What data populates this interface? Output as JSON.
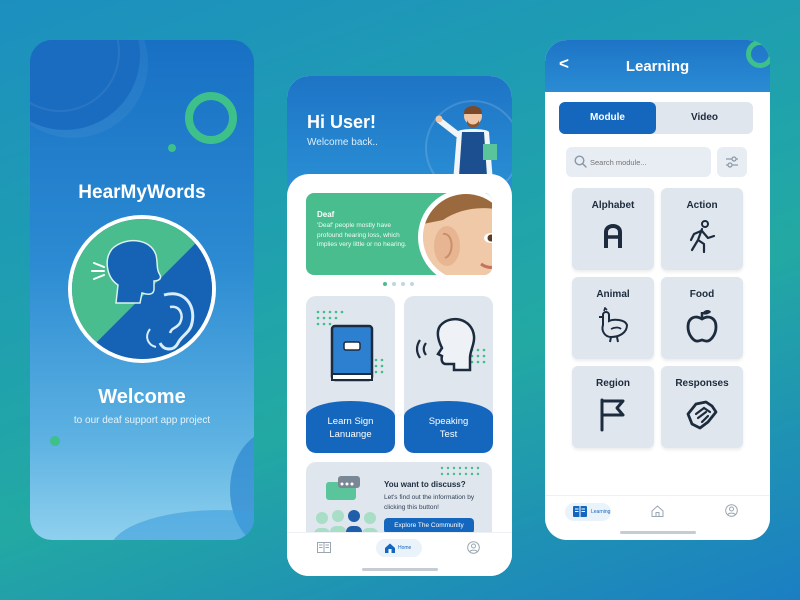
{
  "welcome_screen": {
    "app_title": "HearMyWords",
    "heading": "Welcome",
    "subtitle": "to our deaf support app project"
  },
  "home_screen": {
    "greeting": "Hi User!",
    "welcome_back": "Welcome back..",
    "banner": {
      "title": "Deaf",
      "description": "'Deaf' people mostly have profound hearing loss, which implies very little or no hearing."
    },
    "carousel_dots": 4,
    "tiles": [
      {
        "label_line1": "Learn Sign",
        "label_line2": "Lanuange"
      },
      {
        "label_line1": "Speaking",
        "label_line2": "Test"
      }
    ],
    "community": {
      "question": "You want to discuss?",
      "description": "Let's find out the information by clicking this button!",
      "button": "Explore The Community"
    },
    "nav": {
      "home_label": "Home"
    }
  },
  "learning_screen": {
    "back_glyph": "<",
    "title": "Learning",
    "tabs": [
      "Module",
      "Video"
    ],
    "active_tab": "Module",
    "search_placeholder": "Search module...",
    "modules": [
      {
        "label": "Alphabet",
        "icon": "letter-a-icon"
      },
      {
        "label": "Action",
        "icon": "running-person-icon"
      },
      {
        "label": "Animal",
        "icon": "chicken-icon"
      },
      {
        "label": "Food",
        "icon": "apple-icon"
      },
      {
        "label": "Region",
        "icon": "flag-icon"
      },
      {
        "label": "Responses",
        "icon": "handshake-icon"
      }
    ],
    "nav": {
      "learning_label": "Learning"
    }
  },
  "colors": {
    "primary_blue": "#1467bd",
    "accent_green": "#3dc08a",
    "card_grey": "#dfe6ee",
    "text_dark": "#1c2b3d"
  }
}
